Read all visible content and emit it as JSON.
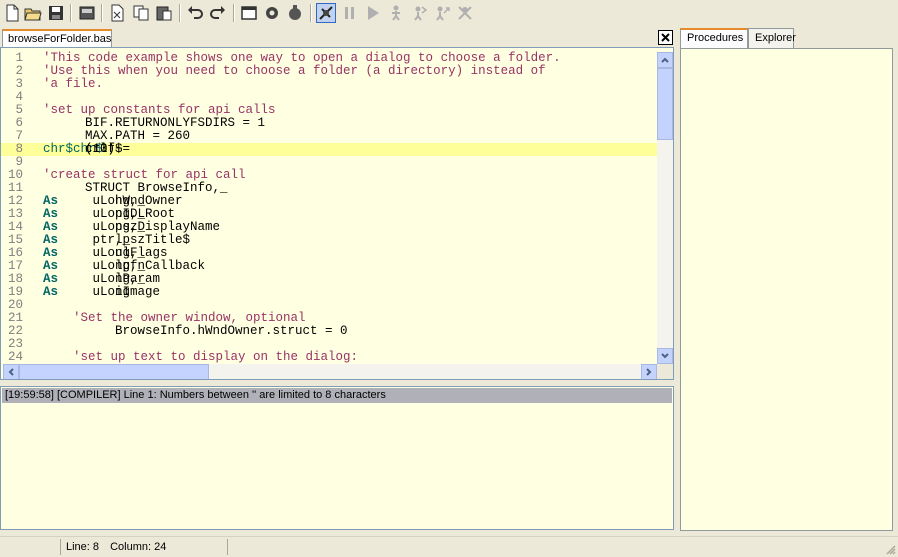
{
  "toolbar": {
    "buttons": [
      "new-file",
      "open-file",
      "save-file",
      "open-folder",
      "cut",
      "copy",
      "paste",
      "undo",
      "redo",
      "window",
      "settings",
      "compile",
      "debug",
      "pause",
      "run",
      "step",
      "step-over",
      "step-out",
      "stop"
    ]
  },
  "editor": {
    "tab_label": "browseForFolder.bas",
    "lines": [
      {
        "n": "1",
        "parts": [
          [
            "cmt",
            "'This code example shows one way to open a dialog to choose a folder."
          ]
        ]
      },
      {
        "n": "2",
        "parts": [
          [
            "cmt",
            "'Use this when you need to choose a folder (a directory) instead of"
          ]
        ]
      },
      {
        "n": "3",
        "parts": [
          [
            "cmt",
            "'a file."
          ]
        ]
      },
      {
        "n": "4",
        "parts": []
      },
      {
        "n": "5",
        "parts": [
          [
            "cmt",
            "'set up constants for api calls"
          ]
        ]
      },
      {
        "n": "6",
        "parts": [
          [
            "txt",
            "BIF.RETURNONLYFSDIRS = 1"
          ]
        ]
      },
      {
        "n": "7",
        "parts": [
          [
            "txt",
            "MAX.PATH = 260"
          ]
        ]
      },
      {
        "n": "8",
        "parts": [
          [
            "txt",
            "crlf$="
          ],
          [
            "bi",
            "chr$"
          ],
          [
            "txt",
            "(13)+"
          ],
          [
            "bi",
            "chr$"
          ],
          [
            "txt",
            "(10)"
          ]
        ],
        "hl": true
      },
      {
        "n": "9",
        "parts": []
      },
      {
        "n": "10",
        "parts": [
          [
            "cmt",
            "'create struct for api call"
          ]
        ]
      },
      {
        "n": "11",
        "parts": [
          [
            "txt",
            "STRUCT BrowseInfo,_"
          ]
        ]
      },
      {
        "n": "12",
        "parts": [
          [
            "txt",
            "    hWndOwner "
          ],
          [
            "kw",
            "As"
          ],
          [
            "txt",
            " uLong,_"
          ]
        ]
      },
      {
        "n": "13",
        "parts": [
          [
            "txt",
            "    pIDLRoot "
          ],
          [
            "kw",
            "As"
          ],
          [
            "txt",
            " uLong,_"
          ]
        ]
      },
      {
        "n": "14",
        "parts": [
          [
            "txt",
            "    pszDisplayName "
          ],
          [
            "kw",
            "As"
          ],
          [
            "txt",
            " uLong,_"
          ]
        ]
      },
      {
        "n": "15",
        "parts": [
          [
            "txt",
            "    lpszTitle$ "
          ],
          [
            "kw",
            "As"
          ],
          [
            "txt",
            " ptr,_"
          ]
        ]
      },
      {
        "n": "16",
        "parts": [
          [
            "txt",
            "    ulFlags "
          ],
          [
            "kw",
            "As"
          ],
          [
            "txt",
            " uLong,_"
          ]
        ]
      },
      {
        "n": "17",
        "parts": [
          [
            "txt",
            "    lpfnCallback "
          ],
          [
            "kw",
            "As"
          ],
          [
            "txt",
            " uLong,_"
          ]
        ]
      },
      {
        "n": "18",
        "parts": [
          [
            "txt",
            "    lParam "
          ],
          [
            "kw",
            "As"
          ],
          [
            "txt",
            " uLong,_"
          ]
        ]
      },
      {
        "n": "19",
        "parts": [
          [
            "txt",
            "    iImage "
          ],
          [
            "kw",
            "As"
          ],
          [
            "txt",
            " uLong"
          ]
        ]
      },
      {
        "n": "20",
        "parts": []
      },
      {
        "n": "21",
        "parts": [
          [
            "cmt",
            "    'Set the owner window, optional"
          ]
        ]
      },
      {
        "n": "22",
        "parts": [
          [
            "txt",
            "    BrowseInfo.hWndOwner.struct = 0"
          ]
        ]
      },
      {
        "n": "23",
        "parts": []
      },
      {
        "n": "24",
        "parts": [
          [
            "cmt",
            "    'set up text to display on the dialog:"
          ]
        ]
      }
    ]
  },
  "output": {
    "message": "[19:59:58] [COMPILER] Line 1: Numbers between '' are limited to 8 characters"
  },
  "side": {
    "tab_procedures": "Procedures",
    "tab_explorer": "Explorer"
  },
  "status": {
    "line": "Line: 8",
    "column": "Column: 24"
  },
  "colors": {
    "editor_bg": "#ffffe1",
    "comment": "#993366",
    "keyword": "#006666",
    "highlight": "#ffff99",
    "tab_accent": "#e68b2c"
  }
}
